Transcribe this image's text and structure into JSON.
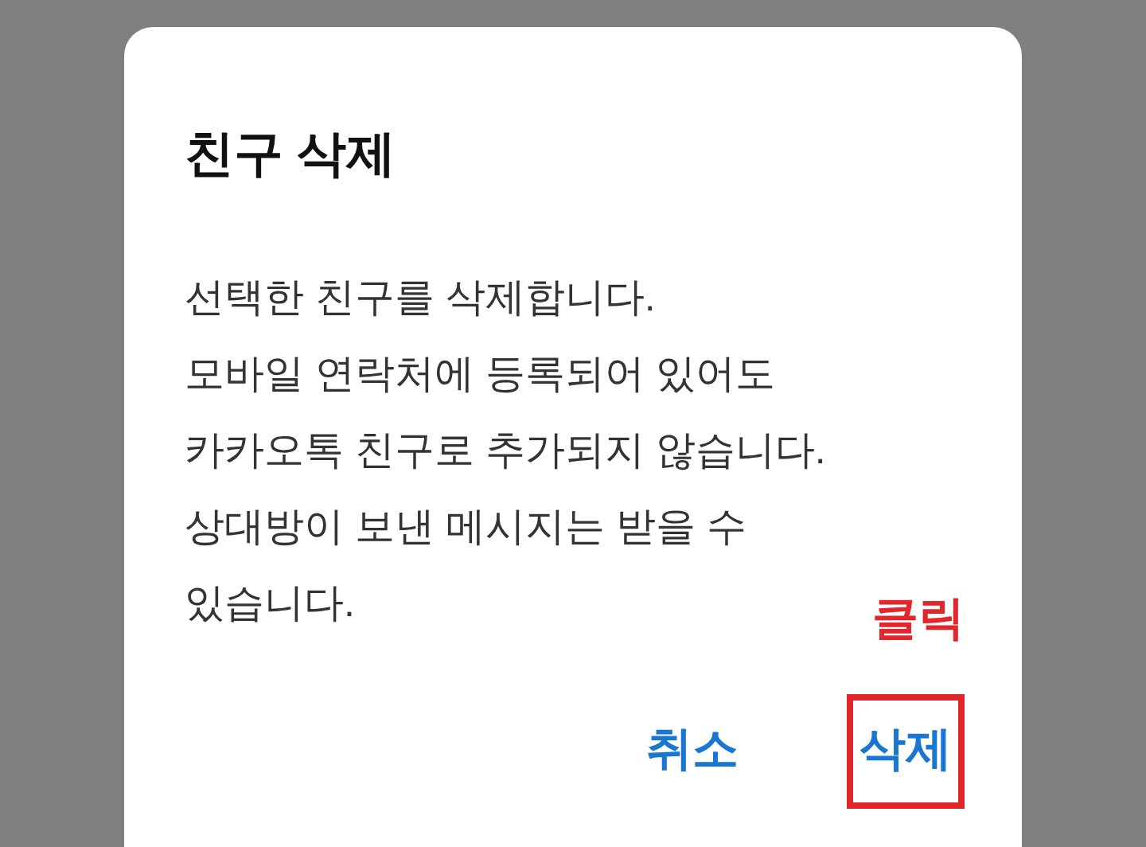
{
  "dialog": {
    "title": "친구 삭제",
    "message_lines": [
      "선택한 친구를 삭제합니다.",
      "모바일 연락처에 등록되어 있어도",
      "카카오톡 친구로 추가되지 않습니다.",
      "상대방이 보낸 메시지는 받을 수",
      "있습니다."
    ],
    "annotation": "클릭",
    "buttons": [
      {
        "label": "취소",
        "highlighted": false
      },
      {
        "label": "삭제",
        "highlighted": true
      }
    ]
  }
}
